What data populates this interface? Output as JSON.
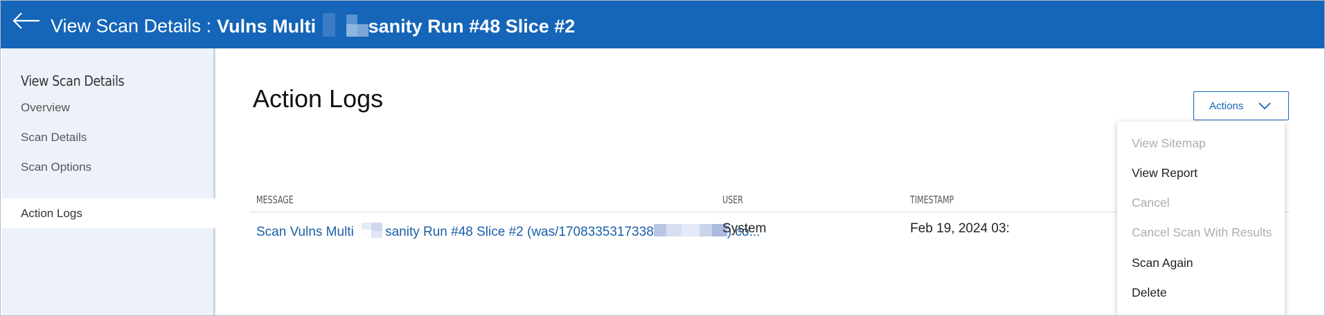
{
  "header": {
    "title_label": "View Scan Details :",
    "scan_name_part1": "Vulns Multi",
    "scan_name_part2": "sanity Run #48 Slice #2",
    "back_icon": "arrow-left-icon"
  },
  "sidebar": {
    "heading": "View Scan Details",
    "items": [
      {
        "label": "Overview",
        "active": false
      },
      {
        "label": "Scan Details",
        "active": false
      },
      {
        "label": "Scan Options",
        "active": false
      },
      {
        "label": "Action Logs",
        "active": true
      }
    ]
  },
  "main": {
    "heading": "Action Logs",
    "actions_button": {
      "label": "Actions",
      "icon": "chevron-down-icon"
    },
    "table": {
      "columns": [
        "MESSAGE",
        "USER",
        "TIMESTAMP"
      ],
      "rows": [
        {
          "message_part1": "Scan Vulns Multi",
          "message_part2": "sanity Run #48 Slice #2 (was/1708335317338",
          "message_part3": ") co...",
          "user": "System",
          "timestamp": "Feb 19, 2024 03:"
        }
      ]
    }
  },
  "actions_menu": {
    "items": [
      {
        "label": "View Sitemap",
        "enabled": false
      },
      {
        "label": "View Report",
        "enabled": true
      },
      {
        "label": "Cancel",
        "enabled": false
      },
      {
        "label": "Cancel Scan With Results",
        "enabled": false
      },
      {
        "label": "Scan Again",
        "enabled": true
      },
      {
        "label": "Delete",
        "enabled": true
      }
    ]
  },
  "colors": {
    "header_bg": "#1565b8",
    "sidebar_bg": "#edf2fa",
    "link": "#1a5fa8",
    "disabled_text": "#a9adb3"
  }
}
